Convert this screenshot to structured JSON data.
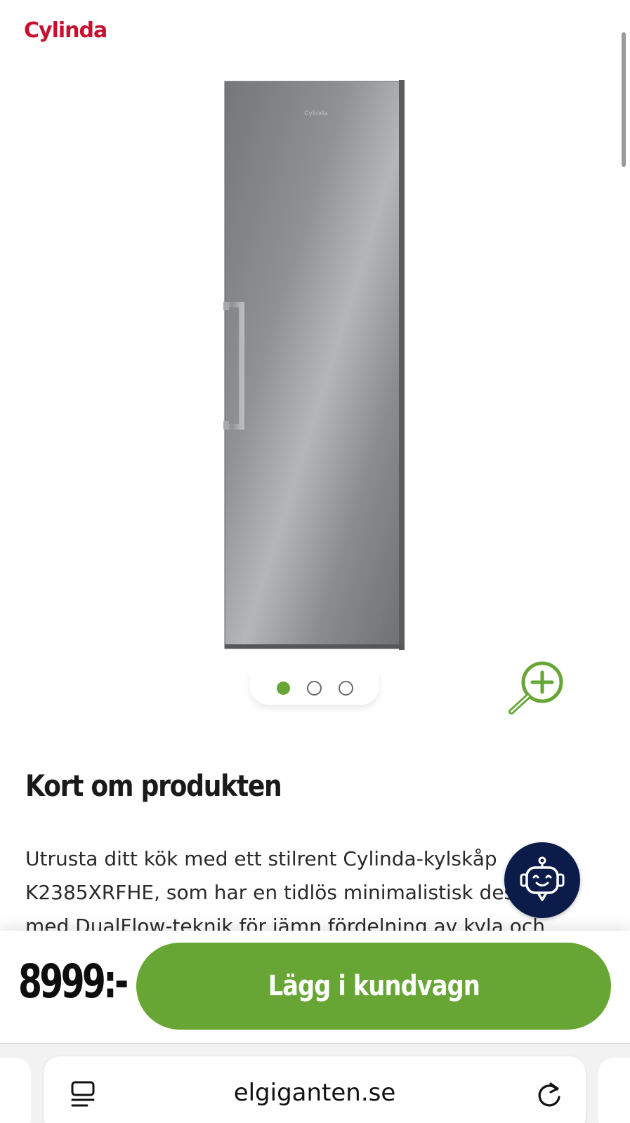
{
  "brand": {
    "logo_text": "Cylinda"
  },
  "product": {
    "image_icon": "refrigerator-image",
    "door_logo_text": "Cylinda",
    "carousel": {
      "count": 3,
      "active_index": 0,
      "active_color": "#67a534"
    },
    "zoom_icon": "zoom-in-icon"
  },
  "section": {
    "title": "Kort om produkten",
    "description": "Utrusta ditt kök med ett stilrent Cylinda-kylskåp K2385XRFHE, som har en tidlös minimalistisk design med DualFlow-teknik för jämn fördelning av kyla och"
  },
  "chat": {
    "icon": "chatbot-icon",
    "color": "#0b1c4a"
  },
  "buy_bar": {
    "price": "8999:-",
    "add_to_cart_label": "Lägg i kundvagn",
    "button_color": "#67a534"
  },
  "browser": {
    "url": "elgiganten.se",
    "reader_icon": "reader-icon",
    "reload_icon": "reload-icon"
  }
}
